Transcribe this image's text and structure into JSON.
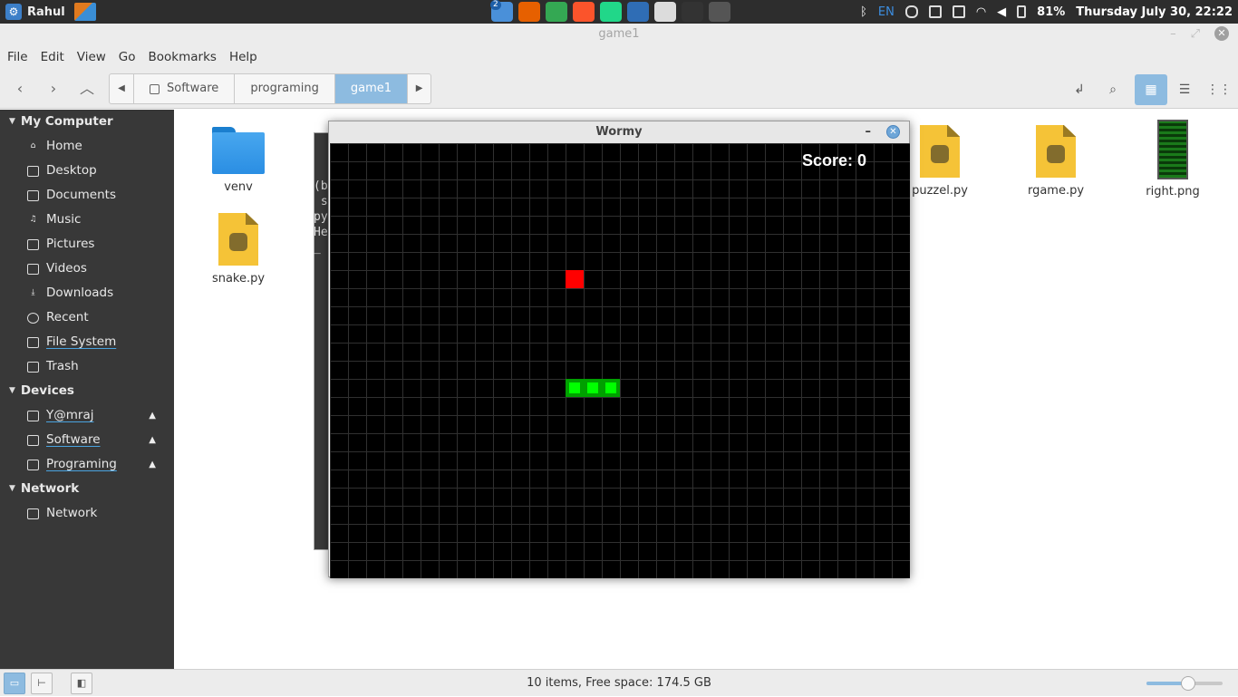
{
  "panel": {
    "user": "Rahul",
    "workspace_badge": "2",
    "lang": "EN",
    "battery": "81%",
    "datetime": "Thursday July 30, 22:22",
    "apps": [
      {
        "name": "files-app-icon",
        "color": "#4a90d9"
      },
      {
        "name": "firefox-icon",
        "color": "#e66000"
      },
      {
        "name": "chrome-icon",
        "color": "#34a853"
      },
      {
        "name": "brave-icon",
        "color": "#fb542b"
      },
      {
        "name": "pycharm-icon",
        "color": "#21d789"
      },
      {
        "name": "wps-writer-icon",
        "color": "#2f6db5"
      },
      {
        "name": "text-editor-icon",
        "color": "#dcdcdc"
      },
      {
        "name": "terminal-icon",
        "color": "#333333"
      },
      {
        "name": "screenshot-icon",
        "color": "#555555"
      }
    ]
  },
  "window": {
    "title": "game1"
  },
  "menu": [
    "File",
    "Edit",
    "View",
    "Go",
    "Bookmarks",
    "Help"
  ],
  "breadcrumbs": [
    "Software",
    "programing",
    "game1"
  ],
  "sidebar": {
    "sections": [
      {
        "title": "My Computer",
        "items": [
          {
            "label": "Home",
            "icon": "home-icon"
          },
          {
            "label": "Desktop",
            "icon": "desktop-icon"
          },
          {
            "label": "Documents",
            "icon": "documents-icon"
          },
          {
            "label": "Music",
            "icon": "music-icon"
          },
          {
            "label": "Pictures",
            "icon": "pictures-icon"
          },
          {
            "label": "Videos",
            "icon": "videos-icon"
          },
          {
            "label": "Downloads",
            "icon": "downloads-icon"
          },
          {
            "label": "Recent",
            "icon": "recent-icon"
          },
          {
            "label": "File System",
            "icon": "drive-icon"
          },
          {
            "label": "Trash",
            "icon": "trash-icon"
          }
        ]
      },
      {
        "title": "Devices",
        "items": [
          {
            "label": "Y@mraj",
            "icon": "drive-icon"
          },
          {
            "label": "Software",
            "icon": "drive-icon"
          },
          {
            "label": "Programing",
            "icon": "drive-icon"
          }
        ]
      },
      {
        "title": "Network",
        "items": [
          {
            "label": "Network",
            "icon": "network-icon"
          }
        ]
      }
    ]
  },
  "files": [
    {
      "name": "venv",
      "type": "folder"
    },
    {
      "name": "snake.py",
      "type": "python"
    },
    {
      "name": "puzzel.py",
      "type": "python"
    },
    {
      "name": "rgame.py",
      "type": "python"
    },
    {
      "name": "right.png",
      "type": "image"
    }
  ],
  "terminal_fragment": "(b\n s\npy\nHe\n_",
  "game": {
    "title": "Wormy",
    "score": "Score: 0",
    "grid": {
      "cols": 32,
      "rows": 24
    },
    "apple": {
      "col": 13,
      "row": 7
    },
    "worm": [
      {
        "col": 13,
        "row": 13
      },
      {
        "col": 14,
        "row": 13
      },
      {
        "col": 15,
        "row": 13
      }
    ]
  },
  "status": {
    "text": "10 items, Free space: 174.5 GB",
    "zoom_level": 0.55
  }
}
